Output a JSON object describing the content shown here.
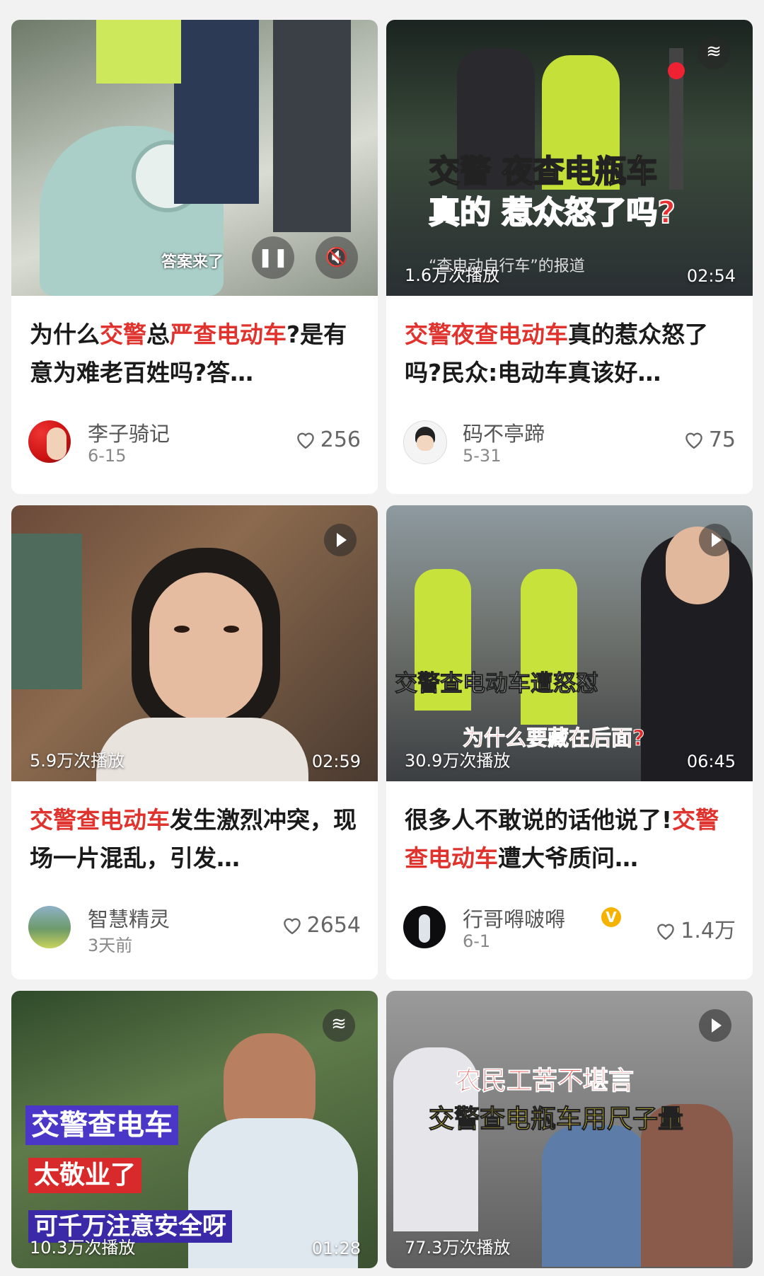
{
  "cards": [
    {
      "title_parts": [
        "为什么",
        "交警",
        "总",
        "严查电动车",
        "?是有意为难老百姓吗?答…"
      ],
      "author": "李子骑记",
      "date": "6-15",
      "likes": "256",
      "overlay_caption": "答案来了"
    },
    {
      "title_parts": [
        "交警夜查电动车",
        "真的惹众怒了吗?民众:电动车真该好…"
      ],
      "author": "码不亭蹄",
      "date": "5-31",
      "likes": "75",
      "views": "1.6万次播放",
      "duration": "02:54",
      "overlay_line1": "交警 夜查电瓶车",
      "overlay_line2": "真的 惹众怒了吗?",
      "overlay_sub": "“查电动自行车”的报道"
    },
    {
      "title_parts": [
        "交警查电动车",
        "发生激烈冲突，现场一片混乱，引发…"
      ],
      "author": "智慧精灵",
      "date": "3天前",
      "likes": "2654",
      "views": "5.9万次播放",
      "duration": "02:59"
    },
    {
      "title_parts": [
        "很多人不敢说的话他说了!",
        "交警查电动车",
        "遭大爷质问…"
      ],
      "author": "行哥嘚啵嘚",
      "date": "6-1",
      "likes": "1.4万",
      "views": "30.9万次播放",
      "duration": "06:45",
      "overlay_line1": "交警查电动车遭怒怼",
      "overlay_line2": "为什么要藏在后面?"
    },
    {
      "views": "10.3万次播放",
      "duration": "01:28",
      "overlay_line1": "交警查电车",
      "overlay_line2": "太敬业了",
      "overlay_line3": "可千万注意安全呀"
    },
    {
      "views": "77.3万次播放",
      "overlay_line1": "农民工苦不堪言",
      "overlay_line2": "交警查电瓶车用尺子量"
    }
  ],
  "colors": {
    "highlight": "#e1332d",
    "vip": "#f5b300"
  }
}
